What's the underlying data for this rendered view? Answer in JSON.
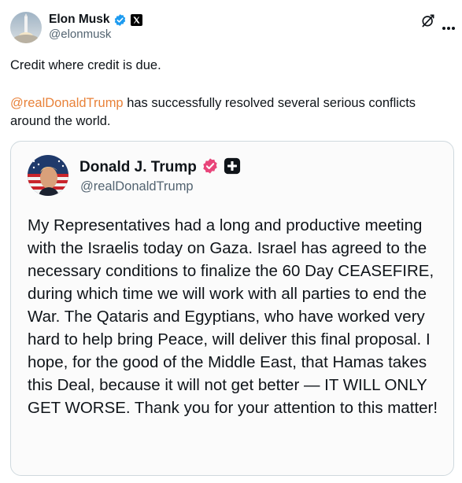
{
  "author": {
    "name": "Elon Musk",
    "handle": "@elonmusk",
    "avatar_icon": "rocket-launch-avatar",
    "verified_icon": "blue-verified-badge",
    "affiliation_icon": "x-logo-badge"
  },
  "actions": {
    "grok_icon": "grok-icon",
    "more_icon": "more-options-icon"
  },
  "post": {
    "line1": "Credit where credit is due.",
    "mention": "@realDonaldTrump",
    "line2_rest": " has successfully resolved several serious conflicts around the world."
  },
  "embedded": {
    "author_name": "Donald J. Trump",
    "author_handle": "@realDonaldTrump",
    "verified_icon": "pink-verified-badge",
    "plus_icon": "plus-badge-icon",
    "body": "My Representatives had a long and productive meeting with the Israelis today on Gaza. Israel has agreed to the necessary conditions to finalize the 60 Day CEASEFIRE, during which time we will work with all parties to end the War. The Qataris and Egyptians, who have worked very hard to help bring Peace, will deliver this final proposal. I hope, for the good of the Middle East, that Hamas takes this Deal, because it will not get better — IT WILL ONLY GET WORSE. Thank you for your attention to this matter!"
  },
  "colors": {
    "mention": "#e8823a",
    "verified_blue": "#1d9bf0",
    "verified_pink": "#e8457a",
    "secondary_text": "#536471"
  }
}
